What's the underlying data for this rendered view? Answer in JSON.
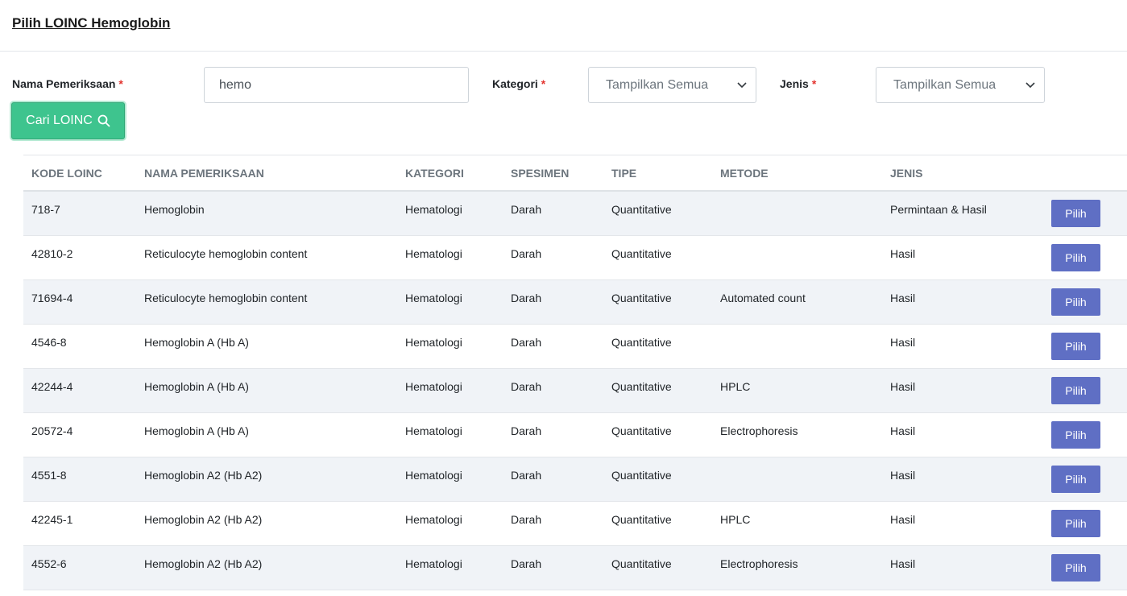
{
  "page": {
    "title": "Pilih LOINC Hemoglobin"
  },
  "form": {
    "nama_label": "Nama Pemeriksaan",
    "nama_value": "hemo",
    "kategori_label": "Kategori",
    "kategori_value": "Tampilkan Semua",
    "jenis_label": "Jenis",
    "jenis_value": "Tampilkan Semua",
    "required_mark": "*",
    "search_label": "Cari LOINC"
  },
  "icons": {
    "search": "search-icon",
    "dropdown": "chevron-down-icon"
  },
  "colors": {
    "search_button": "#3ec48e",
    "pilih_button": "#5f6fc4",
    "required": "#e3342f",
    "striped_row": "#f0f3f7"
  },
  "table": {
    "headers": [
      "KODE LOINC",
      "NAMA PEMERIKSAAN",
      "KATEGORI",
      "SPESIMEN",
      "TIPE",
      "METODE",
      "JENIS"
    ],
    "action_label": "Pilih",
    "rows": [
      {
        "kode": "718-7",
        "nama": "Hemoglobin",
        "kategori": "Hematologi",
        "spesimen": "Darah",
        "tipe": "Quantitative",
        "metode": "",
        "jenis": "Permintaan & Hasil"
      },
      {
        "kode": "42810-2",
        "nama": "Reticulocyte hemoglobin content",
        "kategori": "Hematologi",
        "spesimen": "Darah",
        "tipe": "Quantitative",
        "metode": "",
        "jenis": "Hasil"
      },
      {
        "kode": "71694-4",
        "nama": "Reticulocyte hemoglobin content",
        "kategori": "Hematologi",
        "spesimen": "Darah",
        "tipe": "Quantitative",
        "metode": "Automated count",
        "jenis": "Hasil"
      },
      {
        "kode": "4546-8",
        "nama": "Hemoglobin A (Hb A)",
        "kategori": "Hematologi",
        "spesimen": "Darah",
        "tipe": "Quantitative",
        "metode": "",
        "jenis": "Hasil"
      },
      {
        "kode": "42244-4",
        "nama": "Hemoglobin A (Hb A)",
        "kategori": "Hematologi",
        "spesimen": "Darah",
        "tipe": "Quantitative",
        "metode": "HPLC",
        "jenis": "Hasil"
      },
      {
        "kode": "20572-4",
        "nama": "Hemoglobin A (Hb A)",
        "kategori": "Hematologi",
        "spesimen": "Darah",
        "tipe": "Quantitative",
        "metode": "Electrophoresis",
        "jenis": "Hasil"
      },
      {
        "kode": "4551-8",
        "nama": "Hemoglobin A2 (Hb A2)",
        "kategori": "Hematologi",
        "spesimen": "Darah",
        "tipe": "Quantitative",
        "metode": "",
        "jenis": "Hasil"
      },
      {
        "kode": "42245-1",
        "nama": "Hemoglobin A2 (Hb A2)",
        "kategori": "Hematologi",
        "spesimen": "Darah",
        "tipe": "Quantitative",
        "metode": "HPLC",
        "jenis": "Hasil"
      },
      {
        "kode": "4552-6",
        "nama": "Hemoglobin A2 (Hb A2)",
        "kategori": "Hematologi",
        "spesimen": "Darah",
        "tipe": "Quantitative",
        "metode": "Electrophoresis",
        "jenis": "Hasil"
      }
    ]
  }
}
